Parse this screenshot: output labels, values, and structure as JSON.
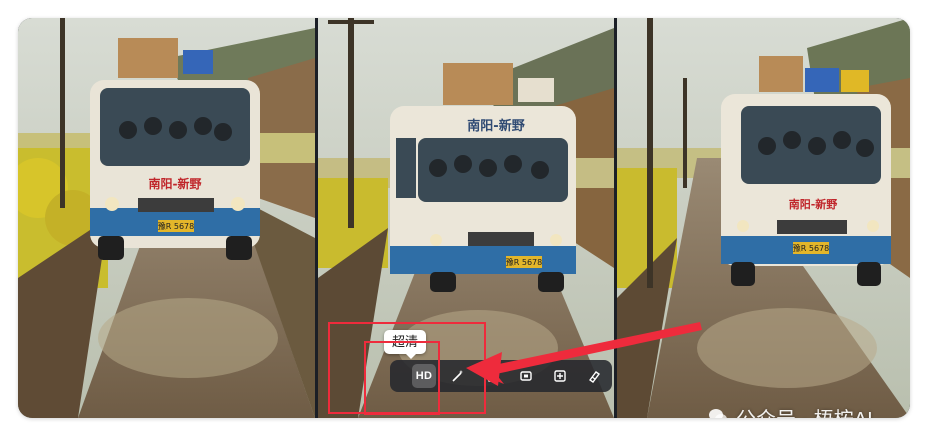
{
  "panels": [
    {
      "route_sign": "南阳-新野",
      "plate": "豫R 5678"
    },
    {
      "route_sign": "南阳-新野",
      "plate": "豫R 5678"
    },
    {
      "route_sign": "南阳-新野",
      "plate": "豫R 5678"
    }
  ],
  "tooltip": {
    "text": "超清"
  },
  "toolbar": {
    "buttons": [
      {
        "label": "HD",
        "icon": "hd-icon",
        "active": true
      },
      {
        "icon": "magic-wand-icon"
      },
      {
        "icon": "eraser-icon"
      },
      {
        "icon": "expand-frame-icon"
      },
      {
        "icon": "crop-icon"
      },
      {
        "icon": "brush-icon"
      }
    ]
  },
  "annotation": {
    "color": "#ee2b3c"
  },
  "watermark": {
    "text": "公众号 · 梧桉AI"
  }
}
